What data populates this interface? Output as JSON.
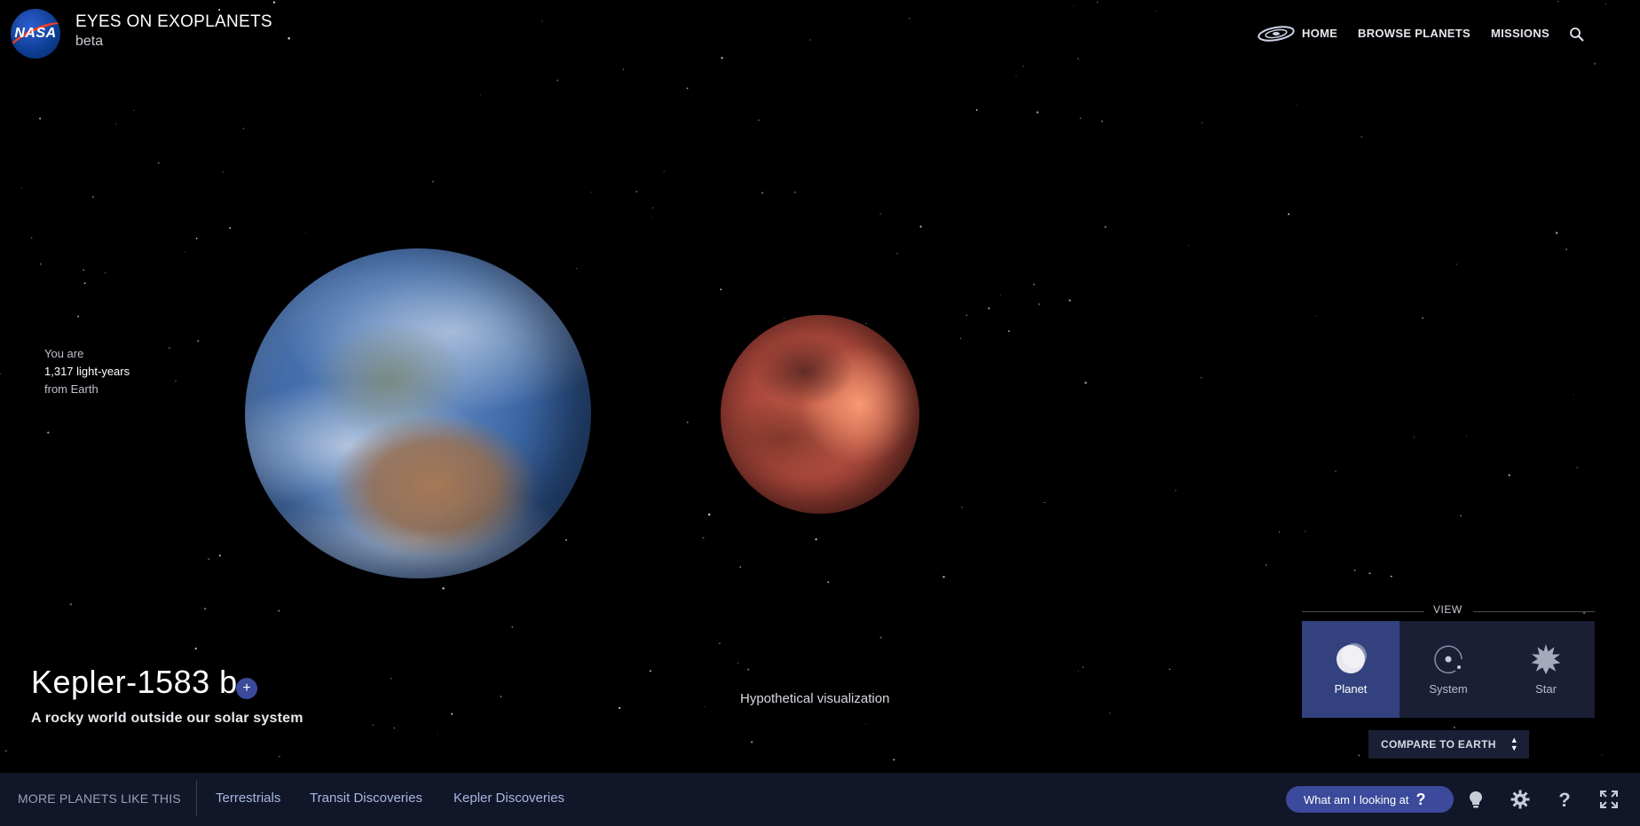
{
  "header": {
    "logo_text": "NASA",
    "app_title": "EYES ON EXOPLANETS",
    "app_subtitle": "beta",
    "nav": [
      {
        "label": "HOME",
        "icon": "galaxy-icon"
      },
      {
        "label": "BROWSE PLANETS"
      },
      {
        "label": "MISSIONS"
      }
    ],
    "search_icon": "search-icon"
  },
  "distance": {
    "line1": "You are",
    "line2": "1,317 light-years",
    "line3": "from Earth"
  },
  "scene": {
    "caption": "Hypothetical visualization",
    "planets": [
      "earth",
      "kepler-1583-b"
    ]
  },
  "planet": {
    "name": "Kepler-1583 b",
    "add_button": "+",
    "tagline": "A rocky world outside our solar system"
  },
  "view": {
    "label": "VIEW",
    "options": [
      {
        "label": "Planet",
        "icon": "planet-icon",
        "active": true
      },
      {
        "label": "System",
        "icon": "system-icon",
        "active": false
      },
      {
        "label": "Star",
        "icon": "star-icon",
        "active": false
      }
    ],
    "compare_label": "COMPARE TO EARTH"
  },
  "bottom_bar": {
    "more_label": "MORE PLANETS LIKE THIS",
    "categories": [
      "Terrestrials",
      "Transit Discoveries",
      "Kepler Discoveries"
    ],
    "looking_label": "What am I looking at",
    "looking_icon": "question-icon",
    "tools": [
      "lightbulb-icon",
      "gear-icon",
      "help-icon",
      "fullscreen-icon"
    ]
  },
  "colors": {
    "background": "#000000",
    "bar": "#111628",
    "panel": "#1b1f35",
    "accent": "#3b4a9a",
    "active_view": "#33427e"
  }
}
